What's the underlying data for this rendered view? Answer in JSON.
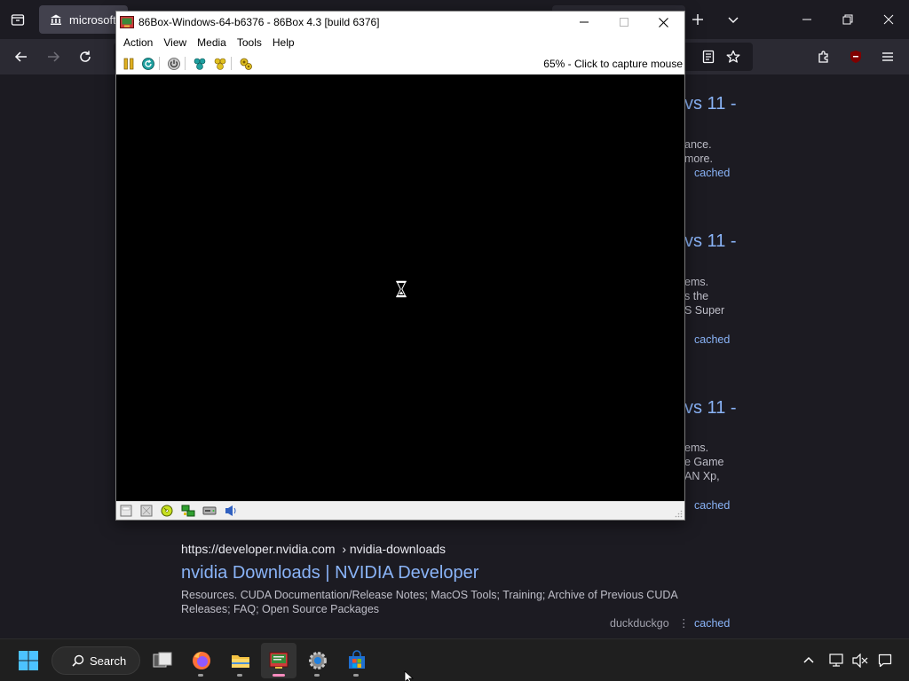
{
  "browser": {
    "active_tab_title": "microsoft",
    "colors": {
      "accent": "#8ab4f8",
      "toolbar": "#2b2a33",
      "background": "#1c1b22"
    }
  },
  "results": [
    {
      "title_fragment": "vs 11 -",
      "snippet_lines": [
        "ance.",
        "more."
      ],
      "cached_label": "cached"
    },
    {
      "title_fragment": "vs 11 -",
      "snippet_lines": [
        "ems.",
        "s the",
        "S Super"
      ],
      "cached_label": "cached"
    },
    {
      "title_fragment": "vs 11 -",
      "snippet_lines": [
        "ems.",
        "e Game",
        "AN Xp,"
      ],
      "cached_label": "cached"
    },
    {
      "url": "https://developer.nvidia.com",
      "url_path": "› nvidia-downloads",
      "title": "nvidia Downloads | NVIDIA Developer",
      "snippet_lines": [
        "Resources. CUDA Documentation/Release Notes; MacOS Tools; Training; Archive of Previous CUDA",
        "Releases; FAQ; Open Source Packages"
      ],
      "source": "duckduckgo",
      "cached_label": "cached"
    }
  ],
  "vm_window": {
    "title": "86Box-Windows-64-b6376 - 86Box 4.3 [build 6376]",
    "menu": [
      "Action",
      "View",
      "Media",
      "Tools",
      "Help"
    ],
    "status_text": "65% - Click to capture mouse",
    "icons": {
      "toolbar": [
        "pause-icon",
        "reset-icon",
        "power-icon",
        "settings-icon",
        "hard-reset-icon",
        "ctrl-alt-del-icon"
      ],
      "statusbar": [
        "floppy-icon",
        "floppy2-icon",
        "cdrom-icon",
        "network-icon",
        "hdd-icon",
        "sound-icon"
      ]
    }
  },
  "taskbar": {
    "search_label": "Search",
    "apps": [
      "windows-start-icon",
      "task-view-icon",
      "firefox-icon",
      "file-explorer-icon",
      "86box-icon",
      "settings-gear-icon",
      "microsoft-store-icon"
    ]
  }
}
